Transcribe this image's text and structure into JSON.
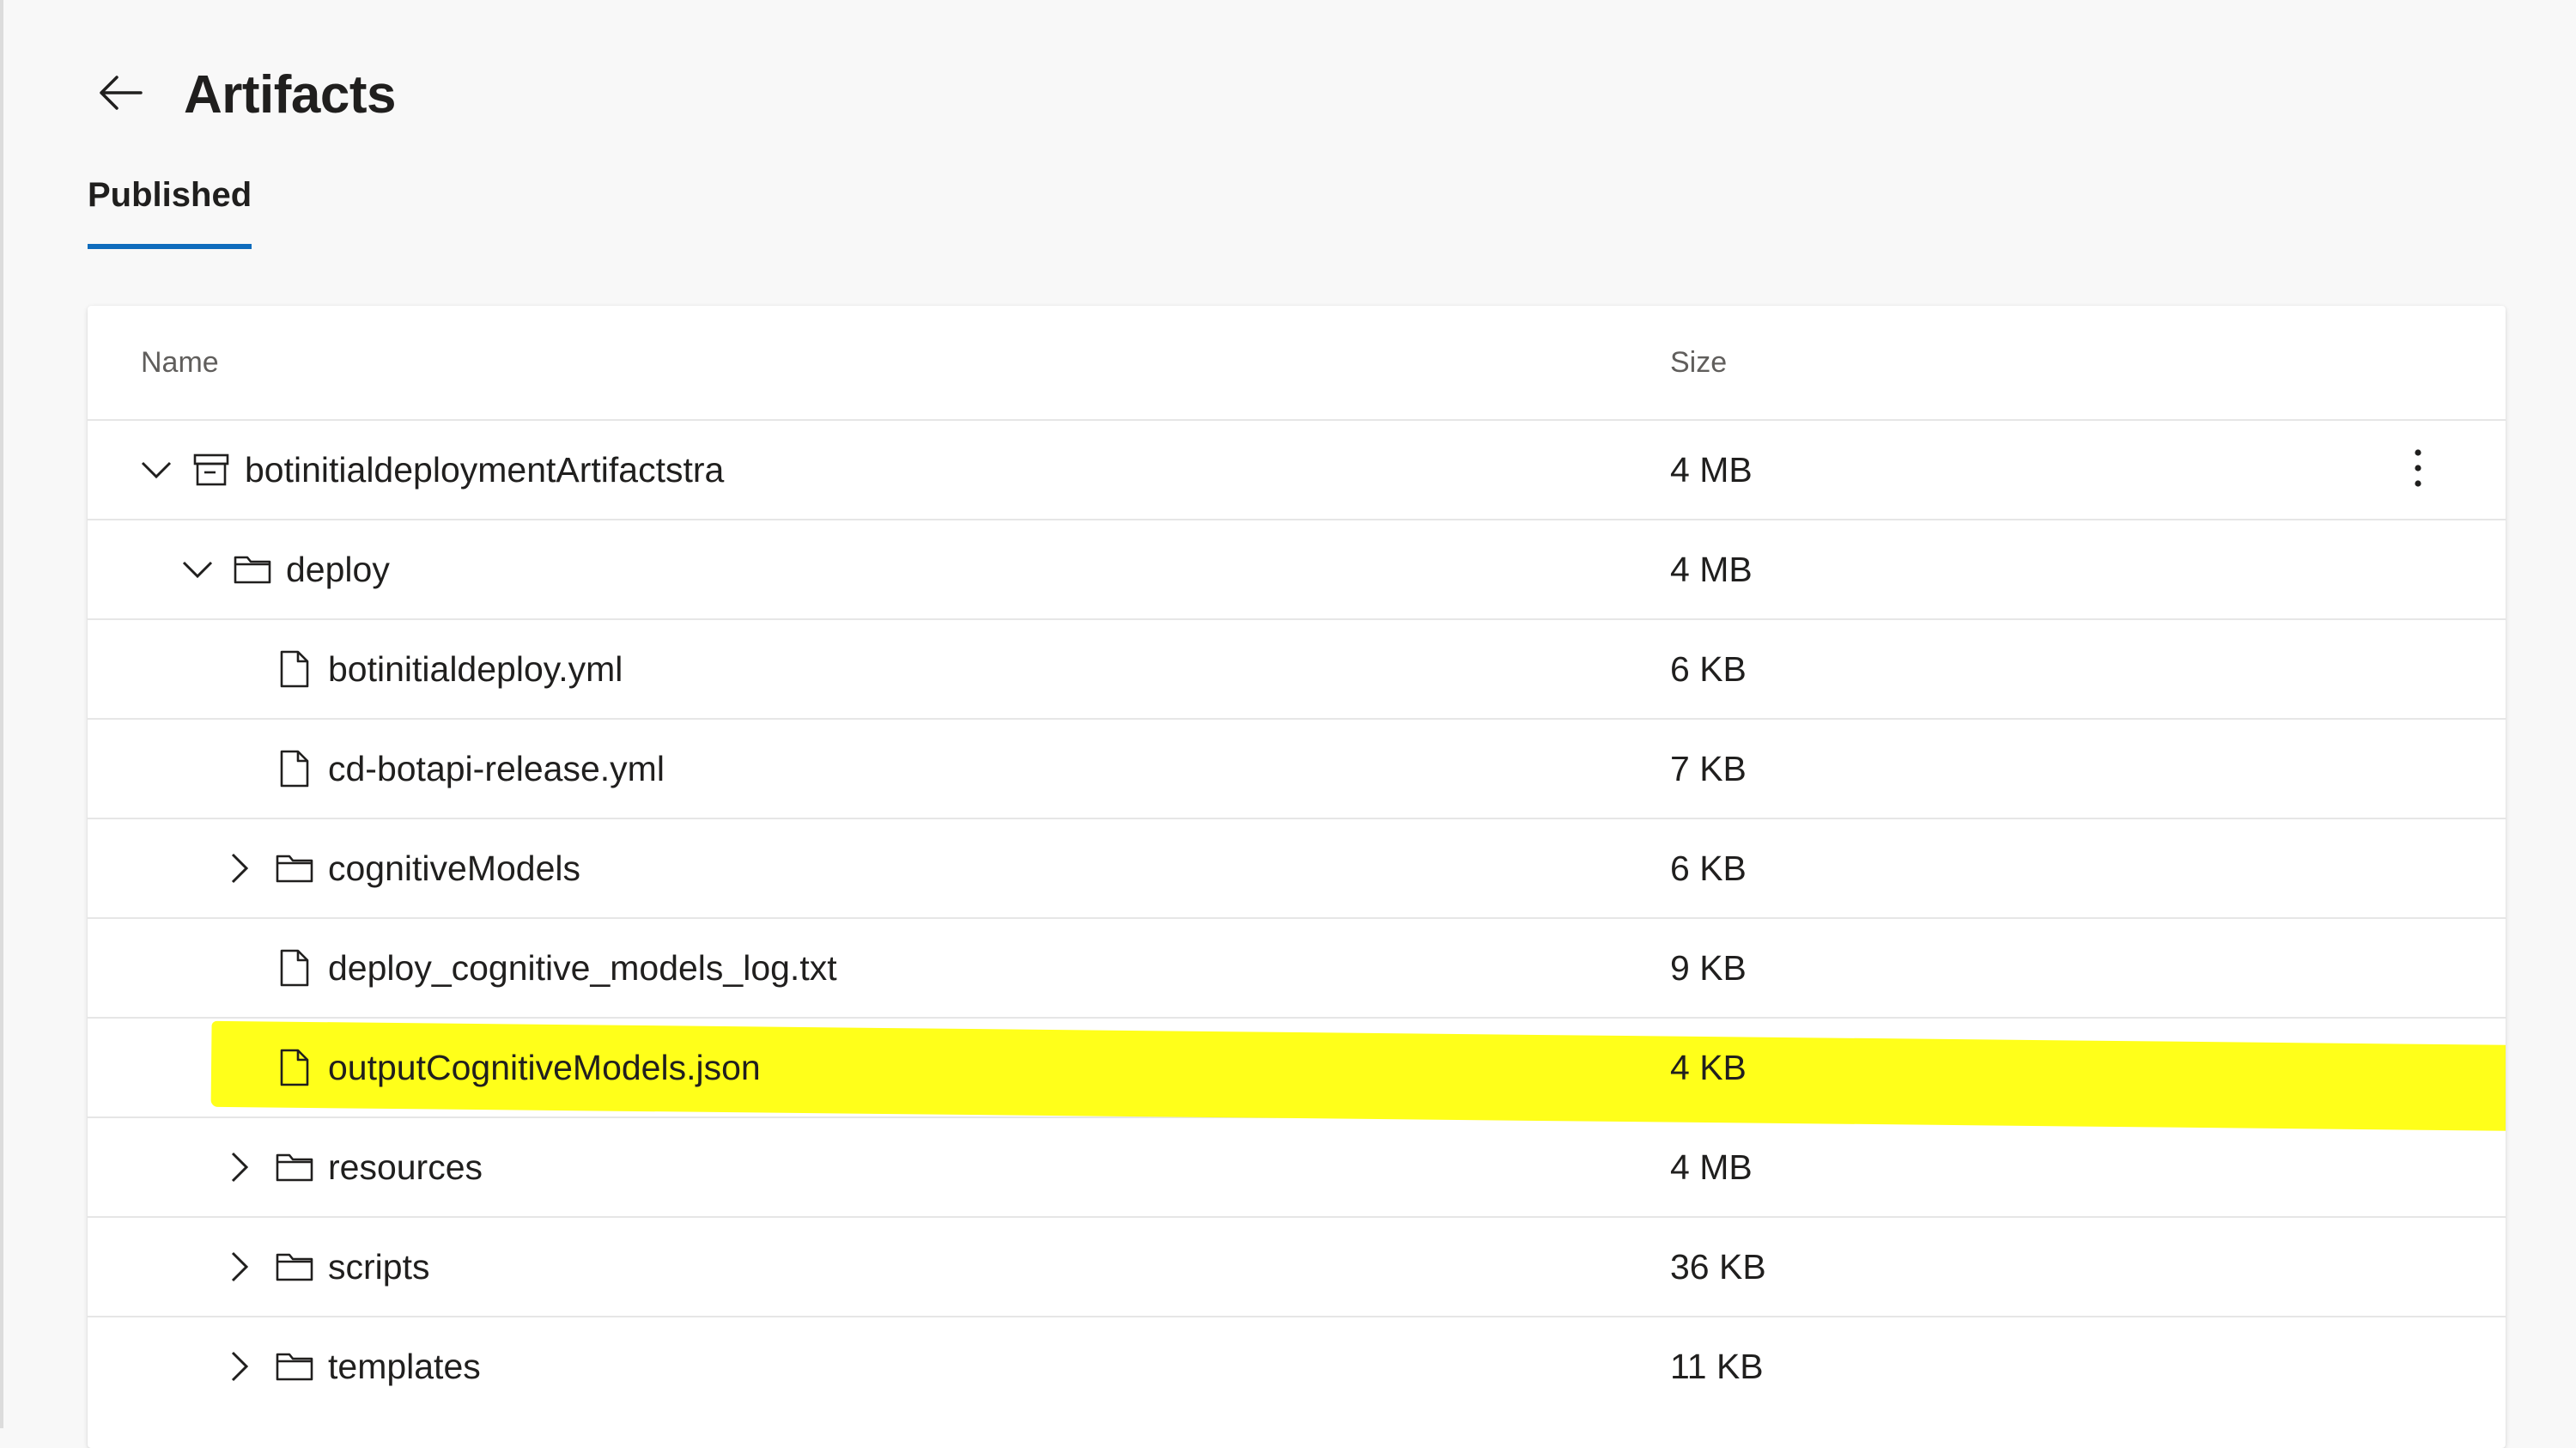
{
  "page": {
    "title": "Artifacts",
    "back_icon": "arrow-left-icon"
  },
  "tabs": [
    {
      "label": "Published",
      "selected": true
    }
  ],
  "table": {
    "columns": {
      "name": "Name",
      "size": "Size"
    },
    "rows": [
      {
        "name": "botinitialdeploymentArtifactstra",
        "size": "4 MB",
        "type": "artifact",
        "icon": "artifact-icon",
        "expanded": true,
        "level": 0,
        "has_more_menu": true
      },
      {
        "name": "deploy",
        "size": "4 MB",
        "type": "folder",
        "icon": "folder-icon",
        "expanded": true,
        "level": 1
      },
      {
        "name": "botinitialdeploy.yml",
        "size": "6 KB",
        "type": "file",
        "icon": "file-icon",
        "level": 2
      },
      {
        "name": "cd-botapi-release.yml",
        "size": "7 KB",
        "type": "file",
        "icon": "file-icon",
        "level": 2
      },
      {
        "name": "cognitiveModels",
        "size": "6 KB",
        "type": "folder",
        "icon": "folder-icon",
        "expanded": false,
        "level": 2
      },
      {
        "name": "deploy_cognitive_models_log.txt",
        "size": "9 KB",
        "type": "file",
        "icon": "file-icon",
        "level": 2
      },
      {
        "name": "outputCognitiveModels.json",
        "size": "4 KB",
        "type": "file",
        "icon": "file-icon",
        "level": 2,
        "highlighted": true
      },
      {
        "name": "resources",
        "size": "4 MB",
        "type": "folder",
        "icon": "folder-icon",
        "expanded": false,
        "level": 2
      },
      {
        "name": "scripts",
        "size": "36 KB",
        "type": "folder",
        "icon": "folder-icon",
        "expanded": false,
        "level": 2
      },
      {
        "name": "templates",
        "size": "11 KB",
        "type": "folder",
        "icon": "folder-icon",
        "expanded": false,
        "level": 2
      }
    ]
  },
  "colors": {
    "tab_underline": "#0f6cbd",
    "highlight": "#ffff1a",
    "background": "#f8f8f8"
  }
}
